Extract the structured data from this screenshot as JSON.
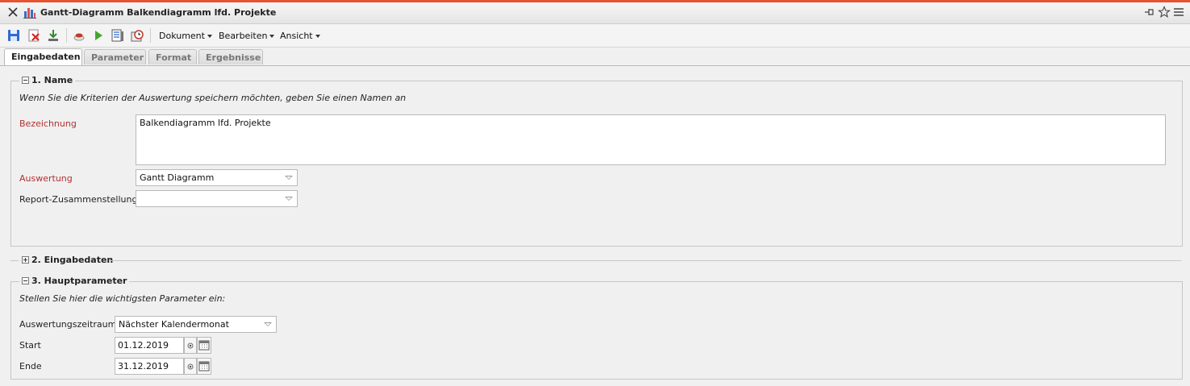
{
  "window": {
    "title": "Gantt-Diagramm Balkendiagramm lfd. Projekte",
    "icons": [
      "close-icon",
      "bar-chart-icon",
      "pin-icon",
      "star-icon",
      "hamburger-menu-icon"
    ]
  },
  "toolbar": {
    "icons": [
      "save-icon",
      "delete-icon",
      "download-icon",
      "coffee-icon",
      "play-icon",
      "report-list-icon",
      "clock-icon"
    ],
    "menus": {
      "dokument": "Dokument",
      "bearbeiten": "Bearbeiten",
      "ansicht": "Ansicht"
    }
  },
  "tabs": {
    "eingabedaten": "Eingabedaten",
    "parameter": "Parameter",
    "format": "Format",
    "ergebnisse": "Ergebnisse",
    "active": "Eingabedaten"
  },
  "section1": {
    "title": "1. Name",
    "hint": "Wenn Sie die Kriterien der Auswertung speichern möchten, geben Sie einen Namen an",
    "bezeichnung_label": "Bezeichnung",
    "bezeichnung_value": "Balkendiagramm lfd. Projekte",
    "auswertung_label": "Auswertung",
    "auswertung_value": "Gantt Diagramm",
    "report_label": "Report-Zusammenstellung",
    "report_value": ""
  },
  "section2": {
    "title": "2. Eingabedaten"
  },
  "section3": {
    "title": "3. Hauptparameter",
    "hint": "Stellen Sie hier die wichtigsten Parameter ein:",
    "zeitraum_label": "Auswertungszeitraum",
    "zeitraum_value": "Nächster Kalendermonat",
    "start_label": "Start",
    "start_value": "01.12.2019",
    "ende_label": "Ende",
    "ende_value": "31.12.2019"
  },
  "colors": {
    "accent_top": "#e8542f",
    "required_label": "#b33030"
  }
}
